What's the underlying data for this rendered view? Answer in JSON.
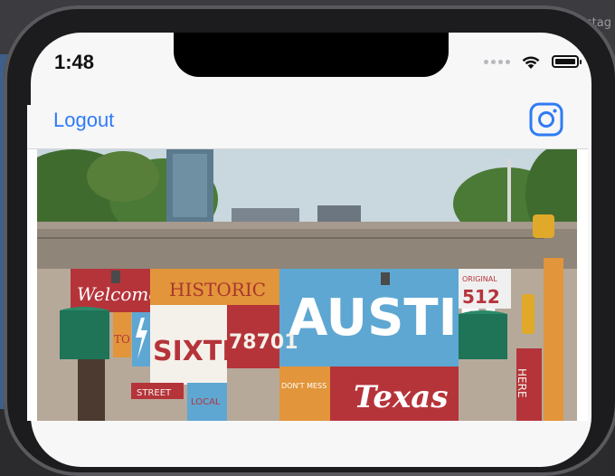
{
  "background": {
    "window_text": "rstag"
  },
  "status_bar": {
    "time": "1:48",
    "wifi_icon": "wifi-icon",
    "battery_icon": "battery-icon"
  },
  "navbar": {
    "logout_label": "Logout",
    "instagram_icon": "instagram-icon"
  },
  "post": {
    "image_description_icon": "photo",
    "mural_text": {
      "welcome": "Welcome",
      "historic": "HISTORIC",
      "austin": "AUSTIN",
      "sixth": "SIXTH",
      "zip": "78701",
      "original": "ORIGINAL",
      "original_number": "512",
      "texas": "Texas",
      "street": "STREET",
      "local": "LOCAL",
      "dont_mess": "DON'T MESS",
      "here": "HERE",
      "to": "TO"
    }
  },
  "colors": {
    "accent": "#2f7bf5",
    "text": "#111111",
    "navbar_bg": "#f7f7f8"
  }
}
